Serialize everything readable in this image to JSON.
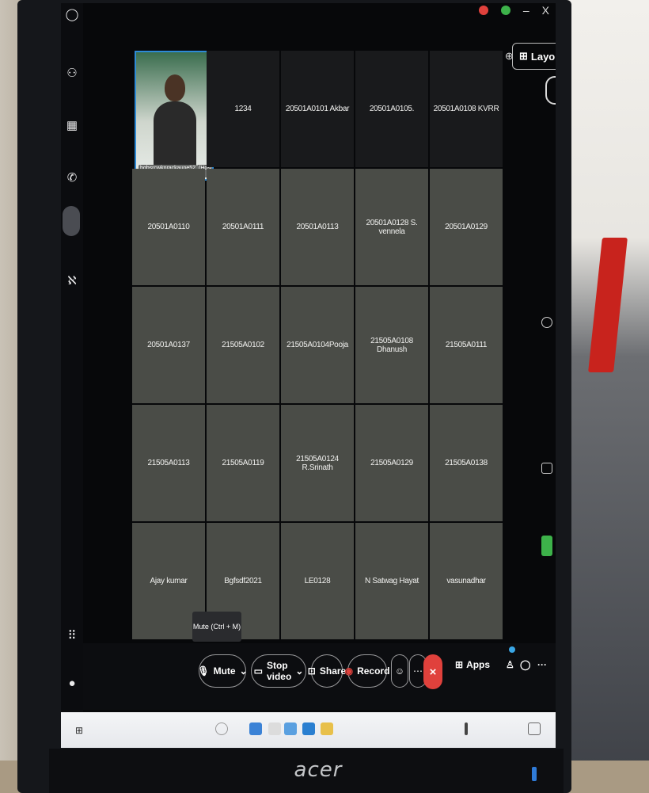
{
  "app": {
    "window_controls": {
      "minimize": "–",
      "close": "X"
    },
    "zoom": {
      "out": "⊖",
      "in": "⊕"
    },
    "layout_label": "Layout"
  },
  "self_view": {
    "name": "bgbsrcwknrackaune52 b...",
    "badge": "(Host...)"
  },
  "participants": [
    [
      "1234",
      "20501A0101 Akbar",
      "20501A0105.",
      "20501A0108 KVRR"
    ],
    [
      "20501A0110",
      "20501A0111",
      "20501A0113",
      "20501A0128 S. vennela",
      "20501A0129"
    ],
    [
      "20501A0137",
      "21505A0102",
      "21505A0104Pooja",
      "21505A0108 Dhanush",
      "21505A0111"
    ],
    [
      "21505A0113",
      "21505A0119",
      "21505A0124 R.Srinath",
      "21505A0129",
      "21505A0138"
    ],
    [
      "Ajay kumar",
      "Bgfsdf2021",
      "LE0128",
      "N Satwag Hayat",
      "vasunadhar"
    ]
  ],
  "tooltip": "Mute (Ctrl + M)",
  "toolbar": {
    "mute": "Mute",
    "stop_video": "Stop video",
    "share": "Share",
    "record": "Record",
    "leave": "×",
    "apps": "Apps",
    "more": "···"
  },
  "monitor_brand": "acer",
  "colors": {
    "leave_red": "#e0413c",
    "self_border": "#2d8ad6",
    "tile_gray": "#4a4c47"
  }
}
